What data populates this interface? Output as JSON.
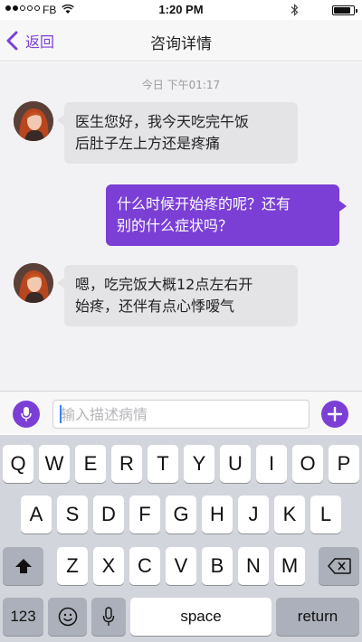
{
  "status_bar": {
    "carrier": "FB",
    "time": "1:20 PM",
    "signal_bars_filled": 2,
    "battery_level": 0.85
  },
  "nav": {
    "back_label": "返回",
    "title": "咨询详情"
  },
  "chat": {
    "timestamp": "今日  下午01:17",
    "messages": [
      {
        "from": "patient",
        "text_lines": [
          "医生您好，我今天吃完午饭",
          "后肚子左上方还是疼痛"
        ]
      },
      {
        "from": "doctor",
        "text_lines": [
          "什么时候开始疼的呢？还有",
          "别的什么症状吗？"
        ]
      },
      {
        "from": "patient",
        "text_lines": [
          "嗯，吃完饭大概12点左右开",
          "始疼，还伴有点心悸嗳气"
        ]
      }
    ]
  },
  "input_bar": {
    "placeholder": "输入描述病情",
    "value": ""
  },
  "keyboard": {
    "row1": [
      "Q",
      "W",
      "E",
      "R",
      "T",
      "Y",
      "U",
      "I",
      "O",
      "P"
    ],
    "row2": [
      "A",
      "S",
      "D",
      "F",
      "G",
      "H",
      "J",
      "K",
      "L"
    ],
    "row3": [
      "Z",
      "X",
      "C",
      "V",
      "B",
      "N",
      "M"
    ],
    "numbers_label": "123",
    "space_label": "space",
    "return_label": "return"
  },
  "colors": {
    "accent": "#7b3fd6",
    "incoming_bubble": "#e4e4e7",
    "chat_background": "#f2f2f4",
    "keyboard_background": "#d2d5db"
  },
  "icons": {
    "back": "chevron-left-icon",
    "mic": "microphone-icon",
    "plus": "plus-icon",
    "shift": "shift-arrow-icon",
    "delete": "backspace-icon",
    "emoji": "emoji-icon",
    "dictation": "microphone-icon"
  }
}
